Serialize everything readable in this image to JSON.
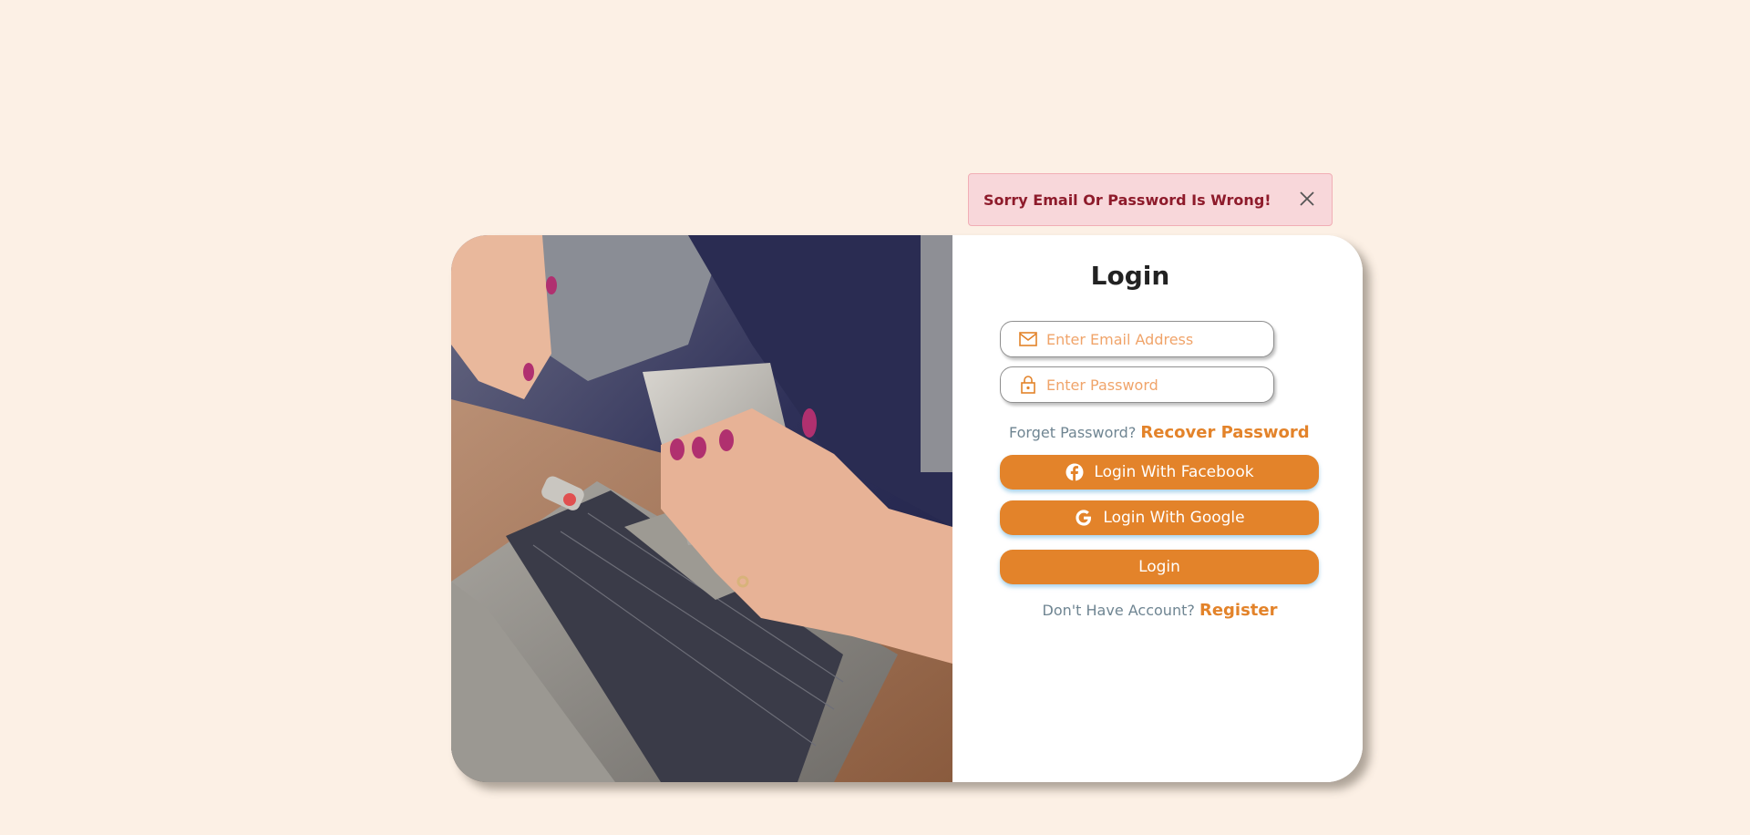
{
  "alert": {
    "message": "Sorry Email Or Password Is Wrong!",
    "close_icon": "close-icon"
  },
  "photo": {
    "description_icon": "photo-hands-phone-laptop"
  },
  "form": {
    "title": "Login",
    "email": {
      "placeholder": "Enter Email Address",
      "value": "",
      "icon": "envelope-icon"
    },
    "password": {
      "placeholder": "Enter Password",
      "value": "",
      "icon": "lock-icon"
    },
    "forgot": {
      "prefix": "Forget Password?",
      "link": "Recover Password"
    },
    "facebook_button": {
      "label": "Login With Facebook",
      "icon": "facebook-icon"
    },
    "google_button": {
      "label": "Login With Google",
      "icon": "google-icon"
    },
    "login_button": {
      "label": "Login"
    },
    "register": {
      "prefix": "Don't Have Account?",
      "link": "Register"
    }
  },
  "colors": {
    "background": "#fcf0e5",
    "accent": "#e3832a",
    "alert_bg": "#f8d7da",
    "alert_text": "#8e1b2b"
  }
}
